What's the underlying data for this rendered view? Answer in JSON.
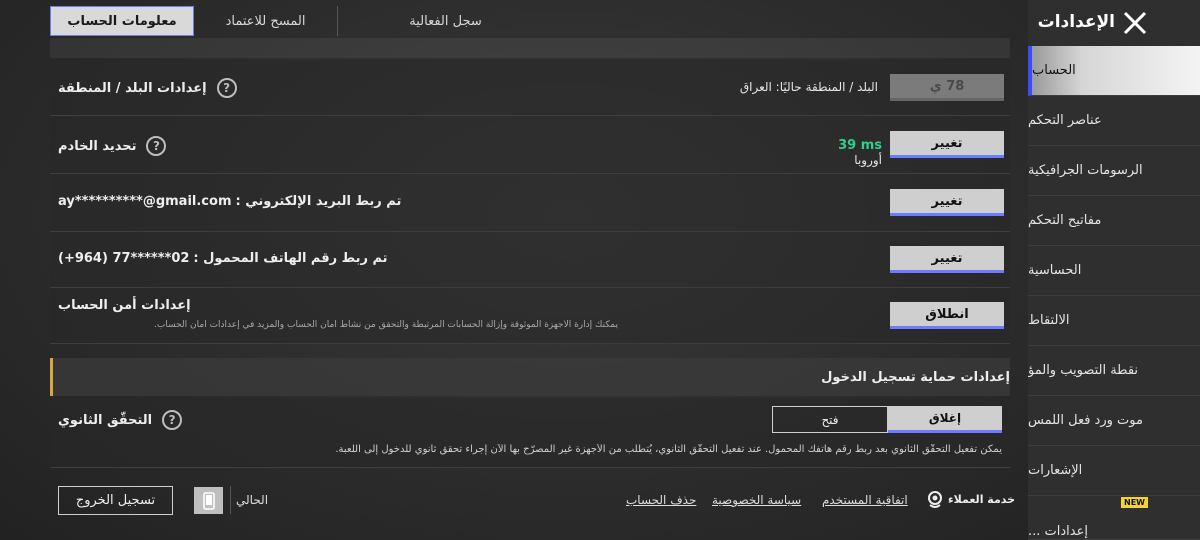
{
  "tabs": [
    {
      "label": "معلومات الحساب",
      "active": true
    },
    {
      "label": "المسح للاعتماد",
      "active": false
    },
    {
      "label": "سجل الفعالية",
      "active": false
    }
  ],
  "rows": {
    "region": {
      "label": "إعدادات البلد / المنطقة",
      "current": "البلد / المنطقة حاليًا: العراق",
      "button": "78 ي"
    },
    "server": {
      "label": "تحديد الخادم",
      "region": "أوروبا",
      "ping": "39 ms",
      "button": "تغيير"
    },
    "email": {
      "label": "تم ربط البريد الإلكتروني :",
      "value": "ay**********@gmail.com",
      "button": "تغيير"
    },
    "phone": {
      "label": "تم ربط رقم الهاتف المحمول :",
      "value": "(+964) 77******02",
      "button": "تغيير"
    },
    "security": {
      "label": "إعدادات أمن الحساب",
      "description": "يمكنك إدارة الأجهزة الموثوقة وإزالة الحسابات المرتبطة والتحقق من نشاط أمان الحساب والمزيد في إعدادات أمان الحساب.",
      "button": "انطلاق"
    }
  },
  "login_protection": {
    "header": "إعدادات حماية تسجيل الدخول",
    "two_factor_label": "التحقّق الثانوي",
    "off_label": "إغلاق",
    "on_label": "فتح",
    "selected": "إغلاق",
    "description": "يمكن تفعيل التحقّق الثانوي بعد ربط رقم هاتفك المحمول. عند تفعيل التحقّق الثانوي، يُتطلّب من الأجهزة غير المصرّح بها الآن إجراء تحقق ثانوي للدخول إلى اللعبة."
  },
  "footer": {
    "logout": "تسجيل الخروج",
    "current": "الحالي",
    "delete_account": "حذف الحساب",
    "privacy": "سياسة الخصوصية",
    "user_agreement": "اتفاقية المستخدم",
    "support": "خدمة العملاء"
  },
  "sidebar": {
    "title": "الإعدادات",
    "items": [
      {
        "label": "الحساب",
        "active": true
      },
      {
        "label": "عناصر التحكم"
      },
      {
        "label": "الرسومات الجرافيكية"
      },
      {
        "label": "مفاتيح التحكم"
      },
      {
        "label": "الحساسية"
      },
      {
        "label": "الالتقاط"
      },
      {
        "label": "نقطة التصويب والمؤ"
      },
      {
        "label": "موت ورد فعل اللمس"
      },
      {
        "label": "الإشعارات"
      },
      {
        "label": "إعدادات ..."
      }
    ],
    "new_badge": "NEW"
  },
  "colors": {
    "accent": "#6b7cff",
    "ping": "#2fcf8c",
    "section_marker": "#d7a93b",
    "new_badge": "#f4d23a"
  }
}
